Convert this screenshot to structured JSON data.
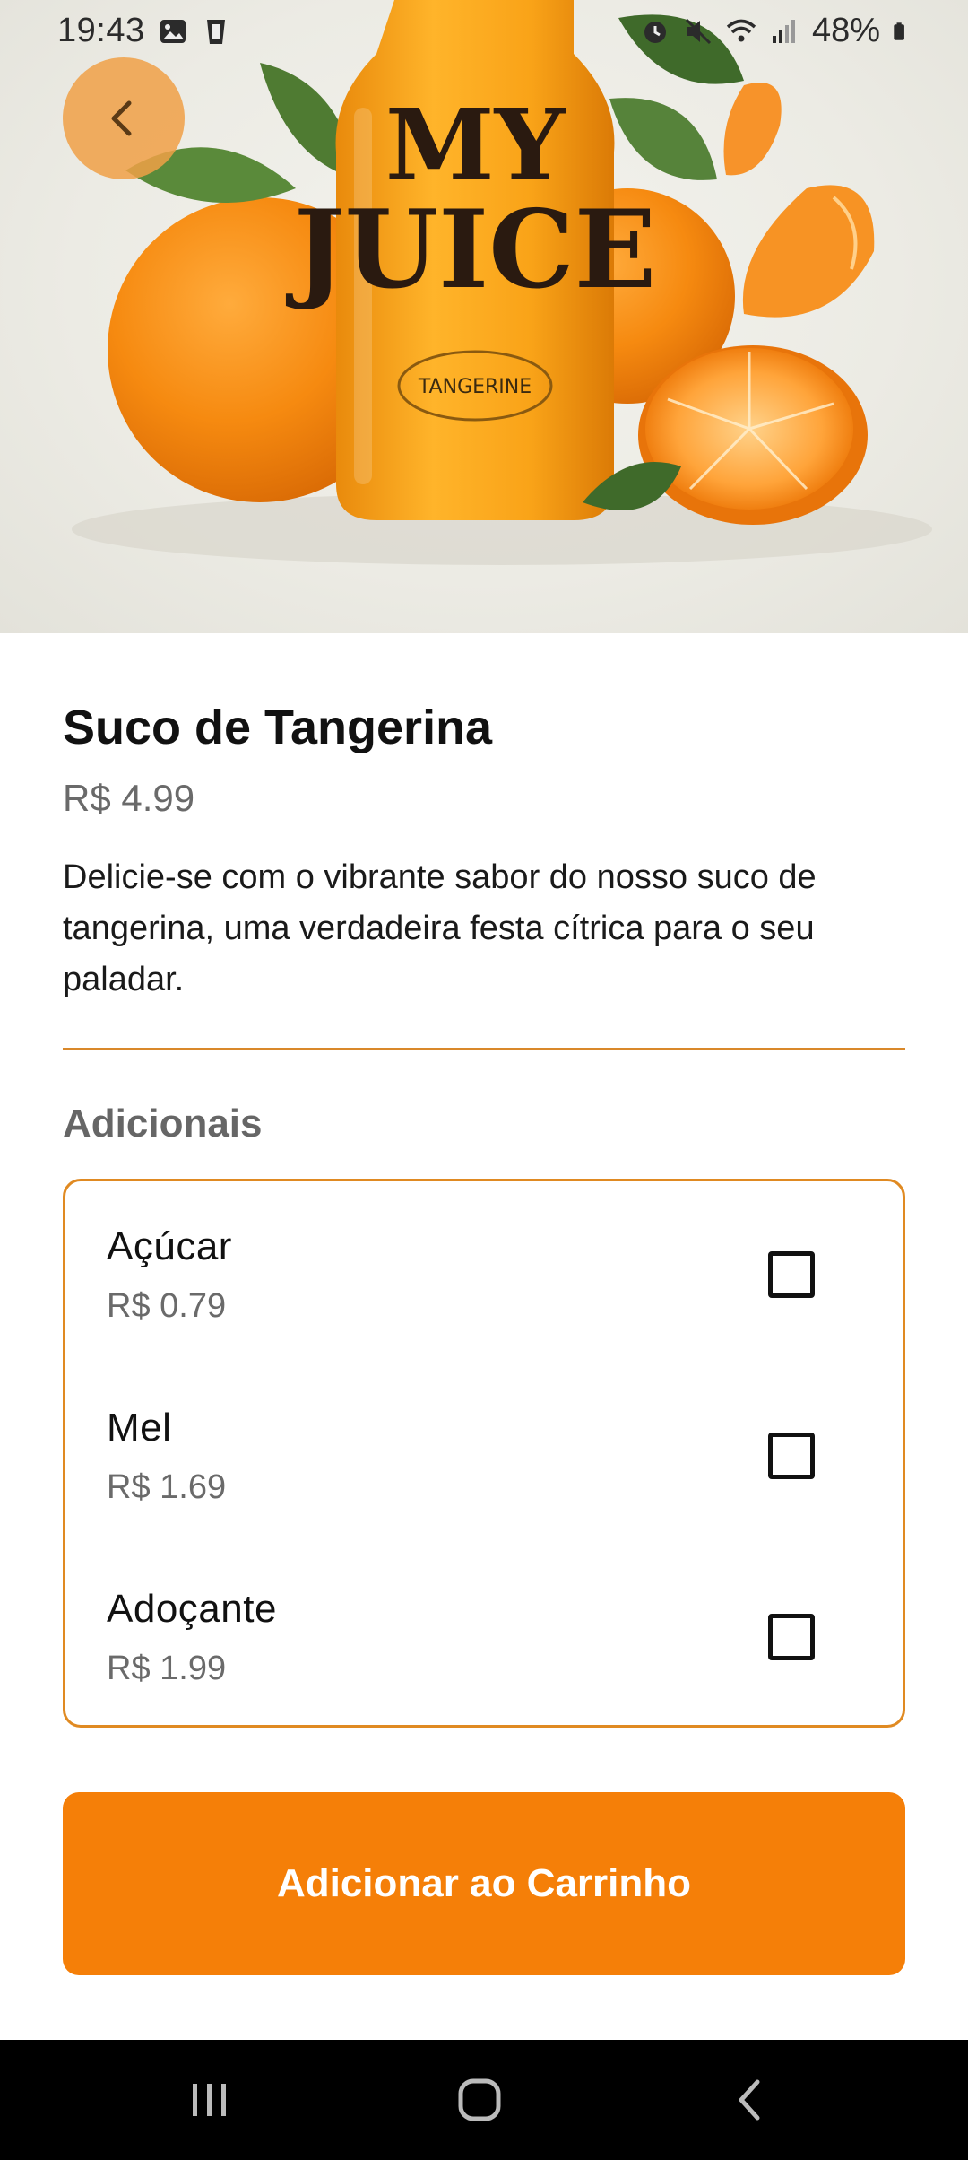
{
  "status_bar": {
    "time": "19:43",
    "battery": "48%",
    "left_icons": [
      "image-icon",
      "cup-icon"
    ],
    "right_icons": [
      "alarm-icon",
      "mute-icon",
      "wifi-icon",
      "signal-icon",
      "battery-icon"
    ]
  },
  "hero": {
    "image": "orange-juice-bottle-with-tangerines",
    "label_text": "MY JUICE",
    "label_sub": "TANGERINE"
  },
  "product": {
    "name": "Suco de Tangerina",
    "price": "R$ 4.99",
    "description": "Delicie-se com o vibrante sabor do nosso suco de tangerina, uma verdadeira festa cítrica para o seu paladar."
  },
  "addons": {
    "title": "Adicionais",
    "items": [
      {
        "name": "Açúcar",
        "price": "R$ 0.79",
        "checked": false
      },
      {
        "name": "Mel",
        "price": "R$ 1.69",
        "checked": false
      },
      {
        "name": "Adoçante",
        "price": "R$ 1.99",
        "checked": false
      }
    ]
  },
  "cart_button": {
    "label": "Adicionar ao Carrinho"
  },
  "colors": {
    "accent": "#f57f08",
    "divider": "#d9882a",
    "back_button": "#f0a046"
  },
  "nav": {
    "items": [
      "recent-apps-icon",
      "home-icon",
      "back-icon"
    ]
  }
}
